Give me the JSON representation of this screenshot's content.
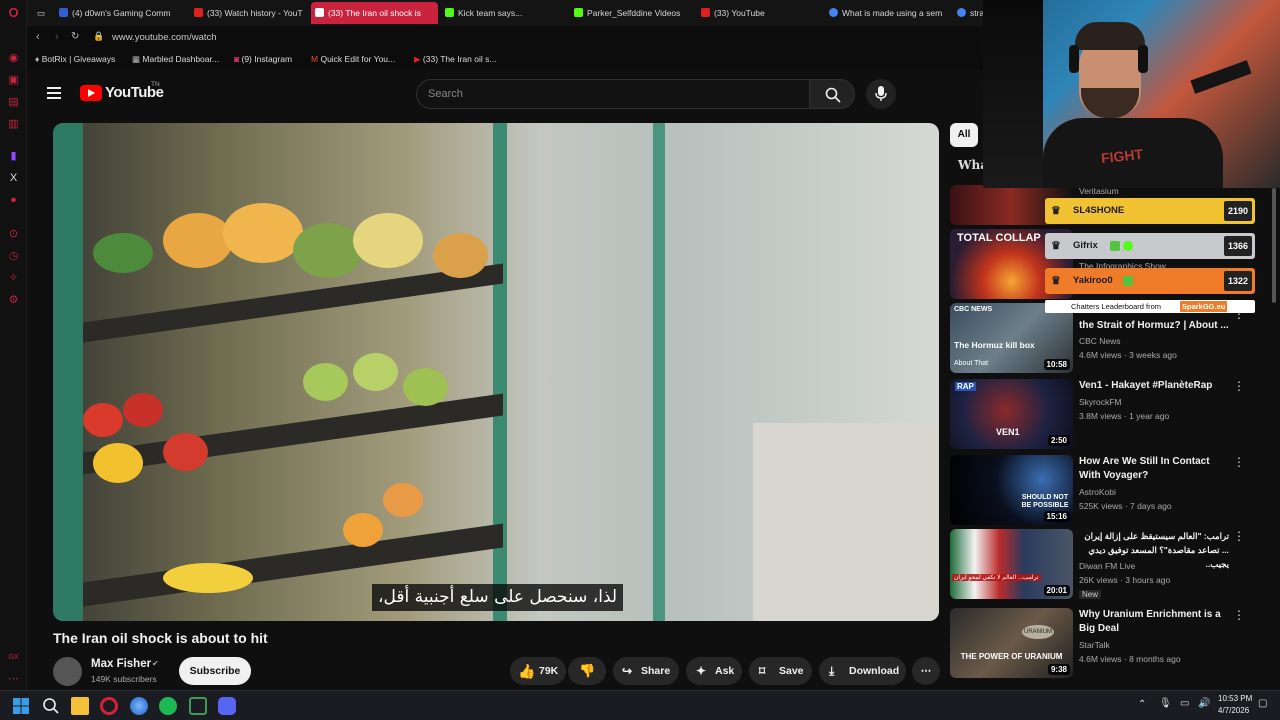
{
  "browser": {
    "tabs": [
      {
        "label": "(4) d0wn's Gaming Comm",
        "color": "#2f5fd0"
      },
      {
        "label": "(33) Watch history - YouT",
        "color": "#e02020"
      },
      {
        "label": "(33) The Iran oil shock is",
        "color": "#e02020",
        "active": true
      },
      {
        "label": "Kick team says...",
        "color": "#53fc18"
      },
      {
        "label": "Parker_Selfddine Videos",
        "color": "#53fc18"
      },
      {
        "label": "(33) YouTube",
        "color": "#e02020"
      },
      {
        "label": "What is made using a sem",
        "color": "#4285f4"
      },
      {
        "label": "stra",
        "color": "#4285f4"
      }
    ],
    "url": "www.youtube.com/watch",
    "bookmarks": [
      {
        "label": "BotRix | Giveaways"
      },
      {
        "label": "Marbled Dashboar..."
      },
      {
        "label": "(9) Instagram"
      },
      {
        "label": "Quick Edit for You..."
      },
      {
        "label": "(33) The Iran oil s..."
      }
    ]
  },
  "youtube": {
    "logo": "YouTube",
    "logo_suffix": "TN",
    "search_placeholder": "Search",
    "video": {
      "subtitle": "لذا، سنحصل على سلع أجنبية أقل،",
      "title": "The Iran oil shock is about to hit",
      "channel": "Max Fisher",
      "subscribers": "149K subscribers",
      "subscribe_label": "Subscribe",
      "likes": "79K",
      "share_label": "Share",
      "ask_label": "Ask",
      "save_label": "Save",
      "download_label": "Download"
    },
    "filter_chip": "All",
    "partial_heading": "Wha",
    "recommendations": [
      {
        "title": "",
        "channel": "Veritasium",
        "meta": "",
        "duration": "",
        "thumb_text": ""
      },
      {
        "title": "",
        "channel": "The Infographics Show",
        "meta": "",
        "duration": "",
        "thumb_text": "TOTAL COLLAP"
      },
      {
        "title": "the Strait of Hormuz? | About ...",
        "channel": "CBC News",
        "meta": "4.6M views · 3 weeks ago",
        "duration": "10:58",
        "thumb_text": "The Hormuz kill box",
        "thumb_sub": "About That",
        "thumb_brand": "CBC NEWS"
      },
      {
        "title": "Ven1 - Hakayet #PlanèteRap",
        "channel": "SkyrockFM",
        "meta": "3.8M views · 1 year ago",
        "duration": "2:50",
        "thumb_text": "VEN1",
        "thumb_brand": "RAP"
      },
      {
        "title": "How Are We Still In Contact With Voyager?",
        "channel": "AstroKobi",
        "meta": "525K views · 7 days ago",
        "duration": "15:16",
        "thumb_text": "SHOULD NOT BE POSSIBLE"
      },
      {
        "title": "ترامب: \"العالم سيستيقظ على إزالة إيران ... تصاعد مقاصدة\"؟ المسعد توفيق ديدي يجيب..",
        "channel": "Diwan FM Live",
        "meta": "26K views · 3 hours ago",
        "badge": "New",
        "duration": "20:01",
        "thumb_text": "ترامب... العالم لا تكفي لمحو ايران"
      },
      {
        "title": "Why Uranium Enrichment is a Big Deal",
        "channel": "StarTalk",
        "meta": "4.6M views · 8 months ago",
        "duration": "9:38",
        "thumb_text": "THE POWER OF URANIUM",
        "thumb_brand": "URANIUM"
      }
    ]
  },
  "leaderboard": {
    "rows": [
      {
        "name": "SL4SHONE",
        "score": "2190",
        "color": "#f1c232"
      },
      {
        "name": "Gifrix",
        "score": "1366",
        "color": "#c7c9cc"
      },
      {
        "name": "Yakiroo0",
        "score": "1322",
        "color": "#f07c2a"
      }
    ],
    "footer_prefix": "Chatters Leaderboard from",
    "footer_brand": "SparkGG.eu"
  },
  "stream_shirt_text": "FIGHT",
  "taskbar": {
    "time": "10:53 PM",
    "date": "4/7/2026"
  }
}
